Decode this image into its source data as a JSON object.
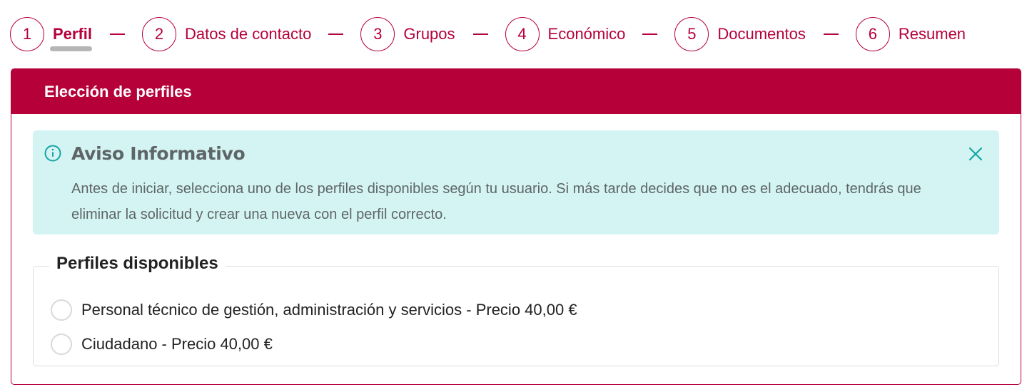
{
  "stepper": {
    "steps": [
      {
        "number": "1",
        "label": "Perfil"
      },
      {
        "number": "2",
        "label": "Datos de contacto"
      },
      {
        "number": "3",
        "label": "Grupos"
      },
      {
        "number": "4",
        "label": "Económico"
      },
      {
        "number": "5",
        "label": "Documentos"
      },
      {
        "number": "6",
        "label": "Resumen"
      }
    ],
    "active_step": "1"
  },
  "card": {
    "title": "Elección de perfiles"
  },
  "alert": {
    "icon": "info-circle-icon",
    "title": "Aviso Informativo",
    "message": "Antes de iniciar, selecciona uno de los perfiles disponibles según tu usuario. Si más tarde decides que no es el adecuado, tendrás que eliminar la solicitud y crear una nueva con el perfil correcto.",
    "close_icon": "close-icon"
  },
  "profiles": {
    "legend": "Perfiles disponibles",
    "options": [
      {
        "label": "Personal técnico de gestión, administración y servicios - Precio 40,00 €",
        "selected": false
      },
      {
        "label": "Ciudadano - Precio 40,00 €",
        "selected": false
      }
    ]
  },
  "colors": {
    "accent": "#b5003a",
    "alert_bg": "#d4f4f4",
    "alert_icon": "#16a5a5",
    "text": "#222222",
    "muted_text": "#5e6566"
  }
}
